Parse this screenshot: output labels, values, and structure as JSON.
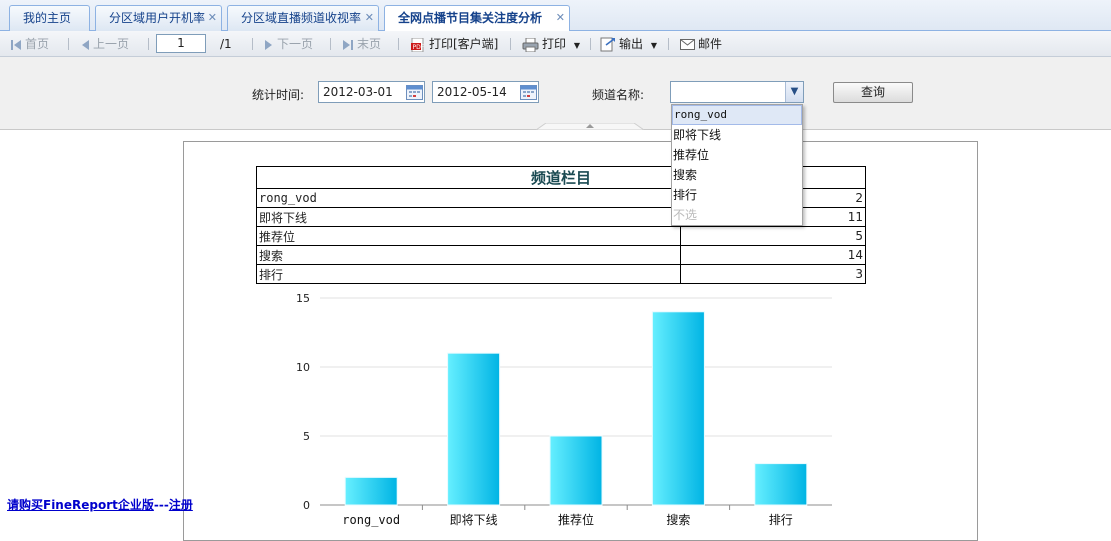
{
  "tabs": [
    {
      "label": "我的主页",
      "closable": false,
      "active": false
    },
    {
      "label": "分区域用户开机率",
      "closable": true,
      "active": false
    },
    {
      "label": "分区域直播频道收视率",
      "closable": true,
      "active": false
    },
    {
      "label": "全网点播节目集关注度分析",
      "closable": true,
      "active": true
    }
  ],
  "toolbar": {
    "first": "首页",
    "prev": "上一页",
    "page_value": "1",
    "page_total": "/1",
    "next": "下一页",
    "last": "末页",
    "print_client": "打印[客户端]",
    "print": "打印",
    "export": "输出",
    "mail": "邮件"
  },
  "params": {
    "time_label": "统计时间:",
    "start_date": "2012-03-01",
    "end_date": "2012-05-14",
    "channel_label": "频道名称:",
    "channel_value": "",
    "query_label": "查询"
  },
  "dropdown": {
    "options": [
      "rong_vod",
      "即将下线",
      "推荐位",
      "搜索",
      "排行",
      "不选"
    ]
  },
  "report": {
    "header": "频道栏目",
    "rows": [
      {
        "name": "rong_vod",
        "value": "2"
      },
      {
        "name": "即将下线",
        "value": "11"
      },
      {
        "name": "推荐位",
        "value": "5"
      },
      {
        "name": "搜索",
        "value": "14"
      },
      {
        "name": "排行",
        "value": "3"
      }
    ]
  },
  "chart_data": {
    "type": "bar",
    "categories": [
      "rong_vod",
      "即将下线",
      "推荐位",
      "搜索",
      "排行"
    ],
    "values": [
      2,
      11,
      5,
      14,
      3
    ],
    "ylim": [
      0,
      15
    ],
    "yticks": [
      0,
      5,
      10,
      15
    ],
    "grid": true,
    "colors": {
      "bar_light": "#66efff",
      "bar_dark": "#00b4e4"
    }
  },
  "footer": {
    "promo_link": "请购买FineReport企业版",
    "dash": "---",
    "register_link": "注册"
  }
}
